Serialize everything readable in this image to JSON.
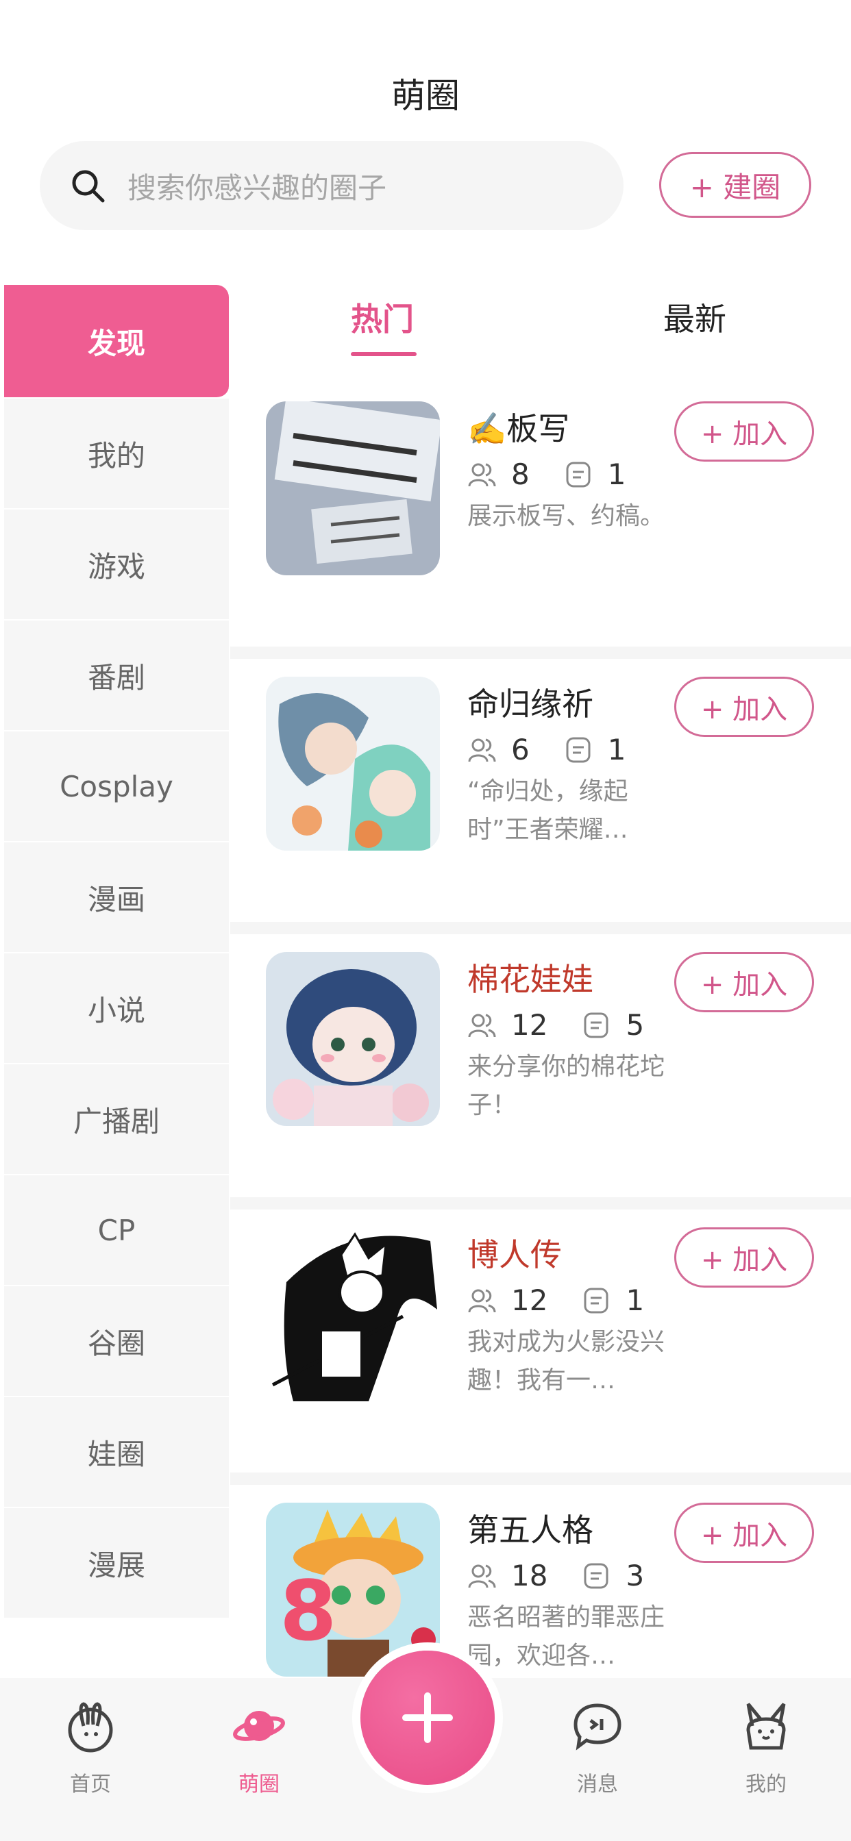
{
  "header": {
    "title": "萌圈"
  },
  "search": {
    "placeholder": "搜索你感兴趣的圈子"
  },
  "create_button": "+ 建圈",
  "sidebar": {
    "items": [
      {
        "label": "发现",
        "active": true
      },
      {
        "label": "我的"
      },
      {
        "label": "游戏"
      },
      {
        "label": "番剧"
      },
      {
        "label": "Cosplay"
      },
      {
        "label": "漫画"
      },
      {
        "label": "小说"
      },
      {
        "label": "广播剧"
      },
      {
        "label": "CP"
      },
      {
        "label": "谷圈"
      },
      {
        "label": "娃圈"
      },
      {
        "label": "漫展"
      }
    ]
  },
  "tabs": [
    {
      "label": "热门",
      "active": true
    },
    {
      "label": "最新"
    }
  ],
  "circles": [
    {
      "name": "✍️板写",
      "members": "8",
      "posts": "1",
      "desc": "展示板写、约稿。",
      "join": "+ 加入",
      "name_color": "#222222"
    },
    {
      "name": "命归缘祈",
      "members": "6",
      "posts": "1",
      "desc": "“命归处，缘起时”王者荣耀…",
      "join": "+ 加入",
      "name_color": "#222222"
    },
    {
      "name": "棉花娃娃",
      "members": "12",
      "posts": "5",
      "desc": "来分享你的棉花坨子！",
      "join": "+ 加入",
      "name_color": "#c0392b"
    },
    {
      "name": "博人传",
      "members": "12",
      "posts": "1",
      "desc": "我对成为火影没兴趣！我有一…",
      "join": "+ 加入",
      "name_color": "#c0392b"
    },
    {
      "name": "第五人格",
      "members": "18",
      "posts": "3",
      "desc": "恶名昭著的罪恶庄园，欢迎各…",
      "join": "+ 加入",
      "name_color": "#222222"
    }
  ],
  "tabbar": {
    "items": [
      {
        "label": "首页",
        "icon": "rabbit-home-icon"
      },
      {
        "label": "萌圈",
        "icon": "planet-icon",
        "active": true
      },
      {
        "label": "",
        "icon": "plus-icon"
      },
      {
        "label": "消息",
        "icon": "chat-bubble-icon"
      },
      {
        "label": "我的",
        "icon": "rabbit-profile-icon"
      }
    ]
  },
  "colors": {
    "accent": "#ef5d92",
    "join_border": "#d36b97",
    "title_red": "#c0392b"
  }
}
